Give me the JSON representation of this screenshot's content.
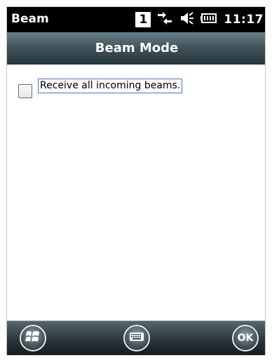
{
  "status_bar": {
    "app_title": "Beam",
    "indicator_number": "1",
    "time": "11:17",
    "icons": [
      "connectivity-icon",
      "volume-icon",
      "battery-icon"
    ]
  },
  "header": {
    "title": "Beam Mode"
  },
  "content": {
    "receive_beams_label": "Receive all incoming beams.",
    "receive_beams_checked": false
  },
  "bottom_bar": {
    "start_icon": "windows-start-icon",
    "keyboard_icon": "keyboard-icon",
    "ok_label": "OK"
  }
}
